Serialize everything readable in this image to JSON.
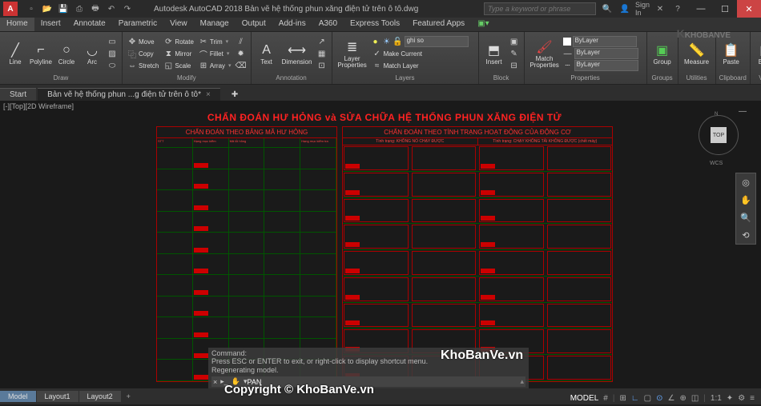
{
  "titlebar": {
    "app_letter": "A",
    "title": "Autodesk AutoCAD 2018   Bản vẽ hệ thống phun xăng điện tử trên ô tô.dwg",
    "search_placeholder": "Type a keyword or phrase",
    "signin": "Sign In"
  },
  "ribbon_tabs": [
    "Home",
    "Insert",
    "Annotate",
    "Parametric",
    "View",
    "Manage",
    "Output",
    "Add-ins",
    "A360",
    "Express Tools",
    "Featured Apps"
  ],
  "ribbon": {
    "draw": {
      "label": "Draw",
      "line": "Line",
      "polyline": "Polyline",
      "circle": "Circle",
      "arc": "Arc"
    },
    "modify": {
      "label": "Modify",
      "move": "Move",
      "rotate": "Rotate",
      "trim": "Trim",
      "copy": "Copy",
      "mirror": "Mirror",
      "fillet": "Fillet",
      "stretch": "Stretch",
      "scale": "Scale",
      "array": "Array"
    },
    "annotation": {
      "label": "Annotation",
      "text": "Text",
      "dimension": "Dimension"
    },
    "layers": {
      "label": "Layers",
      "layer_props": "Layer\nProperties",
      "current": "ghi so",
      "make_current": "Make Current",
      "match_layer": "Match Layer"
    },
    "block": {
      "label": "Block",
      "insert": "Insert"
    },
    "properties": {
      "label": "Properties",
      "match": "Match\nProperties",
      "v1": "ByLayer",
      "v2": "ByLayer",
      "v3": "ByLayer"
    },
    "groups": {
      "label": "Groups",
      "group": "Group"
    },
    "utilities": {
      "label": "Utilities",
      "measure": "Measure"
    },
    "clipboard": {
      "label": "Clipboard",
      "paste": "Paste"
    },
    "view": {
      "label": "View",
      "base": "Base"
    }
  },
  "doc_tabs": {
    "start": "Start",
    "file": "Bản vẽ hệ thống phun ...g điện tử trên ô tô*"
  },
  "viewport": {
    "vp_label": "[-][Top][2D Wireframe]",
    "viewcube_face": "TOP",
    "wcs": "WCS"
  },
  "drawing": {
    "main_title": "CHẨN ĐOÁN HƯ HỎNG và SỬA CHỮA HỆ THỐNG PHUN XĂNG ĐIỆN TỬ",
    "col1_title": "CHẨN ĐOÁN THEO BẢNG MÃ HƯ HỎNG",
    "col2_title": "CHẨN ĐOÁN THEO TÌNH TRẠNG HOẠT ĐỘNG CỦA ĐỘNG CƠ",
    "left_headers": [
      "STT",
      "Hạng mục kiểm",
      "Mã lỗi hỏng",
      "",
      "Hạng mục kiểm tra"
    ],
    "right_sub1": "Tình trạng: KHÔNG NỔ CHẠY ĐƯỢC",
    "right_sub2": "Tình trạng: CHẠY KHÔNG TẢI KHÔNG ĐƯỢC (chết máy)"
  },
  "command": {
    "hist1": "Command:",
    "hist2": "Press ESC or ENTER to exit, or right-click to display shortcut menu.",
    "hist3": "Regenerating model.",
    "prompt": "PAN"
  },
  "watermarks": {
    "logo": "KHOBANVE",
    "wm1": "KhoBanVe.vn",
    "wm2": "Copyright © KhoBanVe.vn"
  },
  "model_tabs": [
    "Model",
    "Layout1",
    "Layout2"
  ],
  "status": {
    "items": [
      "MODEL",
      "#",
      "⊞",
      "∟",
      "▢",
      "⊙",
      "∠",
      "⊕",
      "◫",
      "1:1",
      "✦",
      "⚙",
      "≡"
    ]
  }
}
